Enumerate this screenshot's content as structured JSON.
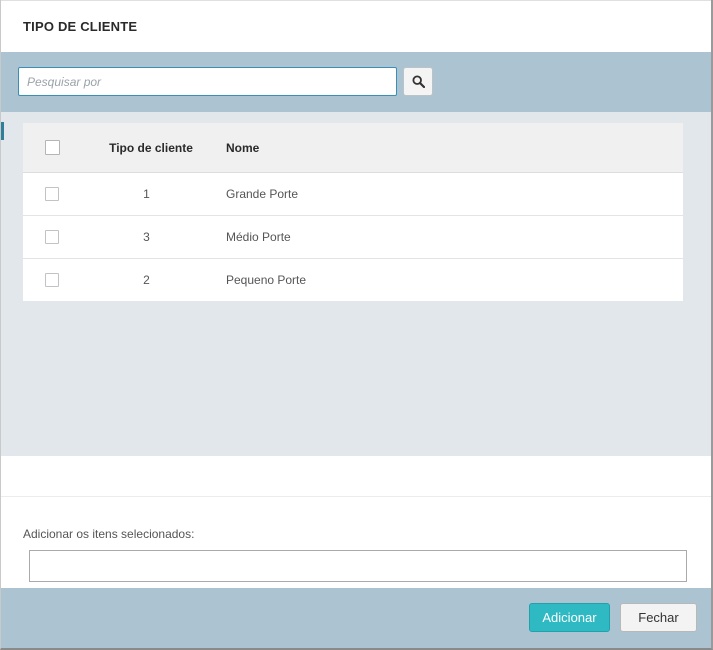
{
  "dialog": {
    "title": "TIPO DE CLIENTE"
  },
  "search": {
    "placeholder": "Pesquisar por",
    "value": "",
    "button_icon": "search-icon"
  },
  "grid": {
    "columns": [
      "Tipo de cliente",
      "Nome"
    ],
    "rows": [
      {
        "code": "1",
        "name": "Grande Porte",
        "checked": false
      },
      {
        "code": "3",
        "name": "Médio Porte",
        "checked": false
      },
      {
        "code": "2",
        "name": "Pequeno Porte",
        "checked": false
      }
    ]
  },
  "selection": {
    "label": "Adicionar os itens selecionados:",
    "value": ""
  },
  "footer": {
    "add_label": "Adicionar",
    "close_label": "Fechar"
  },
  "colors": {
    "band": "#acc4d1",
    "results_bg": "#e1e7ea",
    "add_button": "#2fbac3",
    "focus_border": "#3a8fb7"
  }
}
